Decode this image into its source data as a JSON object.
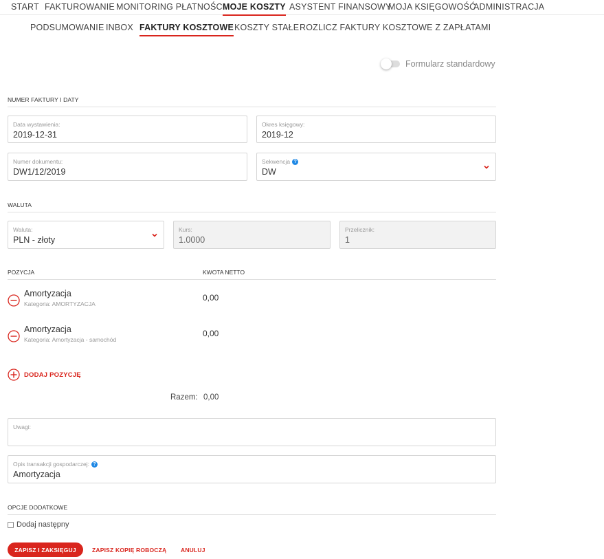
{
  "top_nav": [
    {
      "label": "START"
    },
    {
      "label": "FAKTUROWANIE"
    },
    {
      "label": "MONITORING PŁATNOŚCI"
    },
    {
      "label": "MOJE KOSZTY"
    },
    {
      "label": "ASYSTENT FINANSOWY"
    },
    {
      "label": "MOJA KSIĘGOWOŚĆ"
    },
    {
      "label": "ADMINISTRACJA"
    }
  ],
  "sub_nav": [
    {
      "label": "PODSUMOWANIE"
    },
    {
      "label": "INBOX"
    },
    {
      "label": "FAKTURY KOSZTOWE"
    },
    {
      "label": "KOSZTY STAŁE"
    },
    {
      "label": "ROZLICZ FAKTURY KOSZTOWE Z ZAPŁATAMI"
    }
  ],
  "form_toggle": {
    "label": "Formularz standardowy",
    "enabled": false
  },
  "sections": {
    "invoice": "NUMER FAKTURY I DATY",
    "currency": "WALUTA",
    "options": "OPCJE DODATKOWE"
  },
  "fields": {
    "issue_date": {
      "label": "Data wystawienia:",
      "value": "2019-12-31"
    },
    "accounting_period": {
      "label": "Okres księgowy:",
      "value": "2019-12"
    },
    "document_number": {
      "label": "Numer dokumentu:",
      "value": "DW1/12/2019"
    },
    "sequence": {
      "label": "Sekwencja",
      "value": "DW"
    },
    "currency": {
      "label": "Waluta:",
      "value": "PLN - złoty"
    },
    "rate": {
      "label": "Kurs:",
      "value": "1.0000"
    },
    "converter": {
      "label": "Przelicznik:",
      "value": "1"
    },
    "notes": {
      "label": "Uwagi:",
      "value": ""
    },
    "transaction_description": {
      "label": "Opis transakcji gospodarczej:",
      "value": "Amortyzacja"
    }
  },
  "positions": {
    "col_position": "POZYCJA",
    "col_net_amount": "KWOTA NETTO",
    "items": [
      {
        "name": "Amortyzacja",
        "category": "Kategoria: AMORTYZACJA",
        "amount": "0,00"
      },
      {
        "name": "Amortyzacja",
        "category": "Kategoria: Amortyzacja - samochód",
        "amount": "0,00"
      }
    ],
    "add_label": "DODAJ POZYCJĘ",
    "total_label": "Razem:",
    "total_value": "0,00"
  },
  "options": {
    "add_next_label": "Dodaj następny",
    "add_next_checked": false
  },
  "actions": {
    "save_post": "ZAPISZ I ZAKSIĘGUJ",
    "save_draft": "ZAPISZ KOPIĘ ROBOCZĄ",
    "cancel": "ANULUJ"
  },
  "colors": {
    "accent": "#d9251d",
    "help_icon": "#1e88e5"
  }
}
